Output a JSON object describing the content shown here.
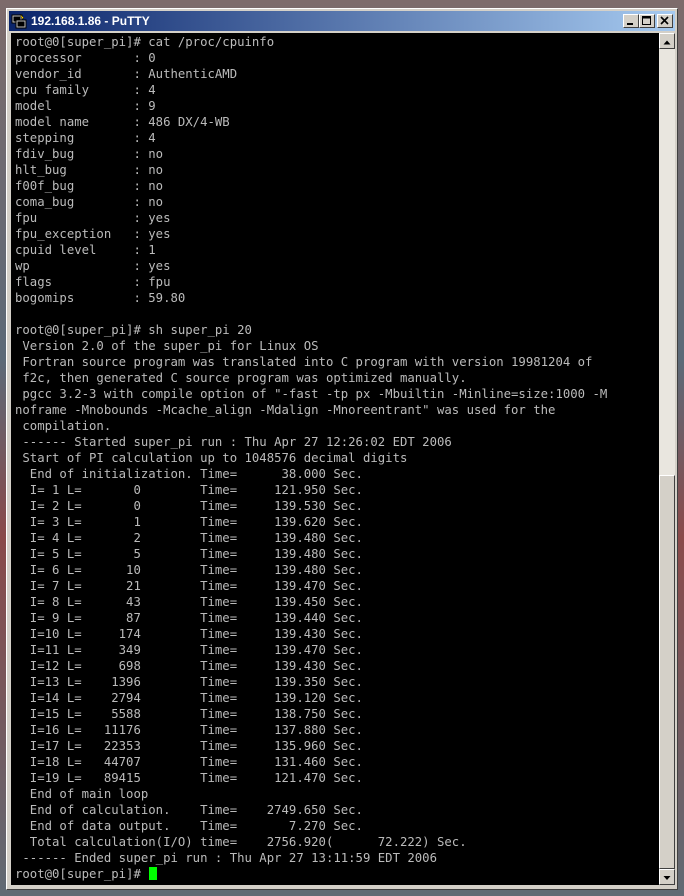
{
  "window": {
    "title": "192.168.1.86 - PuTTY",
    "buttons": {
      "minimize": "minimize-icon",
      "maximize": "maximize-icon",
      "close": "close-icon"
    }
  },
  "terminal": {
    "background": "#000000",
    "foreground": "#bbbbbb",
    "cursor_color": "#00ff00",
    "lines": [
      "root@0[super_pi]# cat /proc/cpuinfo",
      "processor       : 0",
      "vendor_id       : AuthenticAMD",
      "cpu family      : 4",
      "model           : 9",
      "model name      : 486 DX/4-WB",
      "stepping        : 4",
      "fdiv_bug        : no",
      "hlt_bug         : no",
      "f00f_bug        : no",
      "coma_bug        : no",
      "fpu             : yes",
      "fpu_exception   : yes",
      "cpuid level     : 1",
      "wp              : yes",
      "flags           : fpu",
      "bogomips        : 59.80",
      "",
      "root@0[super_pi]# sh super_pi 20",
      " Version 2.0 of the super_pi for Linux OS",
      " Fortran source program was translated into C program with version 19981204 of",
      " f2c, then generated C source program was optimized manually.",
      " pgcc 3.2-3 with compile option of \"-fast -tp px -Mbuiltin -Minline=size:1000 -M",
      "noframe -Mnobounds -Mcache_align -Mdalign -Mnoreentrant\" was used for the",
      " compilation.",
      " ------ Started super_pi run : Thu Apr 27 12:26:02 EDT 2006",
      " Start of PI calculation up to 1048576 decimal digits",
      "  End of initialization. Time=      38.000 Sec.",
      "  I= 1 L=       0        Time=     121.950 Sec.",
      "  I= 2 L=       0        Time=     139.530 Sec.",
      "  I= 3 L=       1        Time=     139.620 Sec.",
      "  I= 4 L=       2        Time=     139.480 Sec.",
      "  I= 5 L=       5        Time=     139.480 Sec.",
      "  I= 6 L=      10        Time=     139.480 Sec.",
      "  I= 7 L=      21        Time=     139.470 Sec.",
      "  I= 8 L=      43        Time=     139.450 Sec.",
      "  I= 9 L=      87        Time=     139.440 Sec.",
      "  I=10 L=     174        Time=     139.430 Sec.",
      "  I=11 L=     349        Time=     139.470 Sec.",
      "  I=12 L=     698        Time=     139.430 Sec.",
      "  I=13 L=    1396        Time=     139.350 Sec.",
      "  I=14 L=    2794        Time=     139.120 Sec.",
      "  I=15 L=    5588        Time=     138.750 Sec.",
      "  I=16 L=   11176        Time=     137.880 Sec.",
      "  I=17 L=   22353        Time=     135.960 Sec.",
      "  I=18 L=   44707        Time=     131.460 Sec.",
      "  I=19 L=   89415        Time=     121.470 Sec.",
      "  End of main loop",
      "  End of calculation.    Time=    2749.650 Sec.",
      "  End of data output.    Time=       7.270 Sec.",
      "  Total calculation(I/O) time=    2756.920(      72.222) Sec.",
      " ------ Ended super_pi run : Thu Apr 27 13:11:59 EDT 2006"
    ],
    "prompt": "root@0[super_pi]# "
  },
  "scrollbar": {
    "position_fraction": 1.0,
    "visible_fraction": 0.48
  }
}
